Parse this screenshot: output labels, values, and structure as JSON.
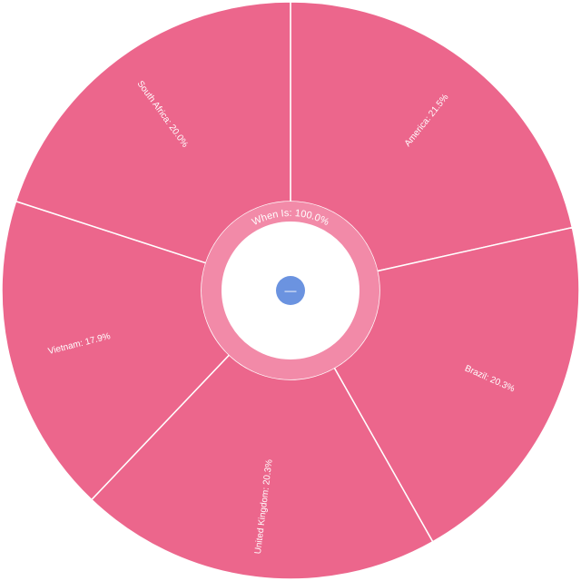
{
  "chart_data": {
    "type": "sunburst",
    "root": {
      "label": "When Is",
      "percent": 100.0,
      "label_text": "When Is: 100.0%"
    },
    "segments": [
      {
        "name": "America",
        "percent": 21.5,
        "label_text": "America: 21.5%"
      },
      {
        "name": "Brazil",
        "percent": 20.3,
        "label_text": "Brazil: 20.3%"
      },
      {
        "name": "United Kingdom",
        "percent": 20.3,
        "label_text": "United Kingdom: 20.3%"
      },
      {
        "name": "Vietnam",
        "percent": 17.9,
        "label_text": "Vietnam: 17.9%"
      },
      {
        "name": "South Africa",
        "percent": 20.0,
        "label_text": "South Africa: 20.0%"
      }
    ],
    "colors": {
      "outer": "#ec668c",
      "inner": "#f28aa8",
      "center_button": "#6b93e0"
    }
  },
  "center_button": {
    "icon": "minus-icon",
    "label": "—"
  }
}
